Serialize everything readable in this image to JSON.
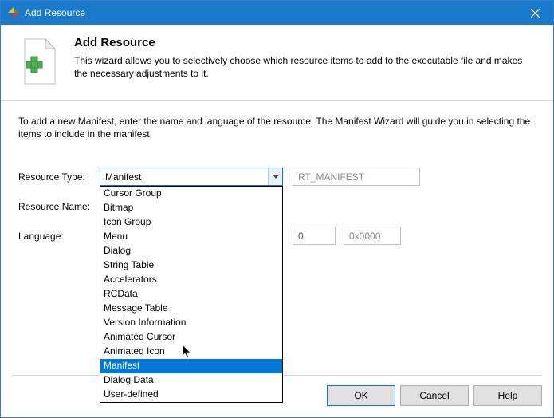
{
  "titlebar": {
    "title": "Add Resource",
    "close_label": "Close"
  },
  "header": {
    "heading": "Add Resource",
    "subheading": "This wizard allows you to selectively choose which resource items to add to the executable file and makes the necessary adjustments to it."
  },
  "intro": "To add a new Manifest, enter the name and language of the resource. The Manifest Wizard will guide you in selecting the items to include in the manifest.",
  "form": {
    "type_label": "Resource Type:",
    "name_label": "Resource Name:",
    "lang_label": "Language:",
    "type_value": "Manifest",
    "rt_value": "RT_MANIFEST",
    "lang_value": "",
    "lang_mid": "0",
    "lang_hex": "0x0000"
  },
  "dropdown": {
    "items": [
      "Cursor Group",
      "Bitmap",
      "Icon Group",
      "Menu",
      "Dialog",
      "String Table",
      "Accelerators",
      "RCData",
      "Message Table",
      "Version Information",
      "Animated Cursor",
      "Animated Icon",
      "Manifest",
      "Dialog Data",
      "User-defined"
    ],
    "highlighted": "Manifest"
  },
  "buttons": {
    "ok": "OK",
    "cancel": "Cancel",
    "help": "Help"
  }
}
